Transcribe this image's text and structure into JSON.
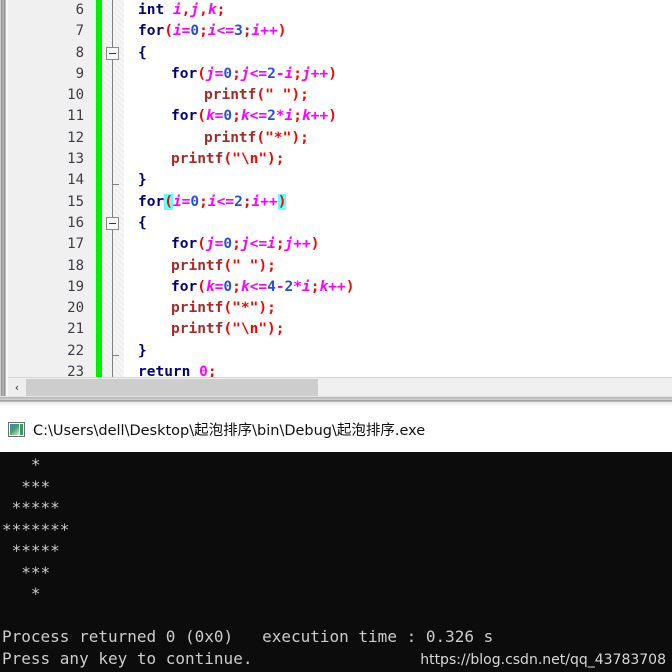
{
  "editor": {
    "first_line_number": 6,
    "gutter_marker_color": "#00ee00",
    "bracket_highlight_color": "#66ffff",
    "lines": [
      {
        "num": "6",
        "indent": 0,
        "text": "int i,j,k;"
      },
      {
        "num": "7",
        "indent": 0,
        "text": "for(i=0;i<=3;i++)"
      },
      {
        "num": "8",
        "indent": 0,
        "text": "{",
        "fold": "box"
      },
      {
        "num": "9",
        "indent": 1,
        "text": "for(j=0;j<=2-i;j++)"
      },
      {
        "num": "10",
        "indent": 2,
        "text": "printf(\" \");"
      },
      {
        "num": "11",
        "indent": 1,
        "text": "for(k=0;k<=2*i;k++)"
      },
      {
        "num": "12",
        "indent": 2,
        "text": "printf(\"*\");"
      },
      {
        "num": "13",
        "indent": 1,
        "text": "printf(\"\\n\");"
      },
      {
        "num": "14",
        "indent": 0,
        "text": "}",
        "fold": "tick"
      },
      {
        "num": "15",
        "indent": 0,
        "text": "for(i=0;i<=2;i++)",
        "highlight_parens": true
      },
      {
        "num": "16",
        "indent": 0,
        "text": "{",
        "fold": "box"
      },
      {
        "num": "17",
        "indent": 1,
        "text": "for(j=0;j<=i;j++)"
      },
      {
        "num": "18",
        "indent": 1,
        "text": "printf(\" \");"
      },
      {
        "num": "19",
        "indent": 1,
        "text": "for(k=0;k<=4-2*i;k++)"
      },
      {
        "num": "20",
        "indent": 1,
        "text": "printf(\"*\");"
      },
      {
        "num": "21",
        "indent": 1,
        "text": "printf(\"\\n\");"
      },
      {
        "num": "22",
        "indent": 0,
        "text": "}",
        "fold": "tick"
      },
      {
        "num": "23",
        "indent": 0,
        "text": "return 0;"
      }
    ],
    "hscroll": {
      "left_arrow": "‹"
    }
  },
  "console": {
    "title": "C:\\Users\\dell\\Desktop\\起泡排序\\bin\\Debug\\起泡排序.exe",
    "icon": "console-window-icon",
    "output_lines": [
      "   *",
      "  ***",
      " *****",
      "*******",
      " *****",
      "  ***",
      "   *",
      "",
      "Process returned 0 (0x0)   execution time : 0.326 s",
      "Press any key to continue."
    ],
    "background": "#0c0c0c",
    "foreground": "#cccccc"
  },
  "watermark": {
    "text": "https://blog.csdn.net/qq_43783708"
  }
}
